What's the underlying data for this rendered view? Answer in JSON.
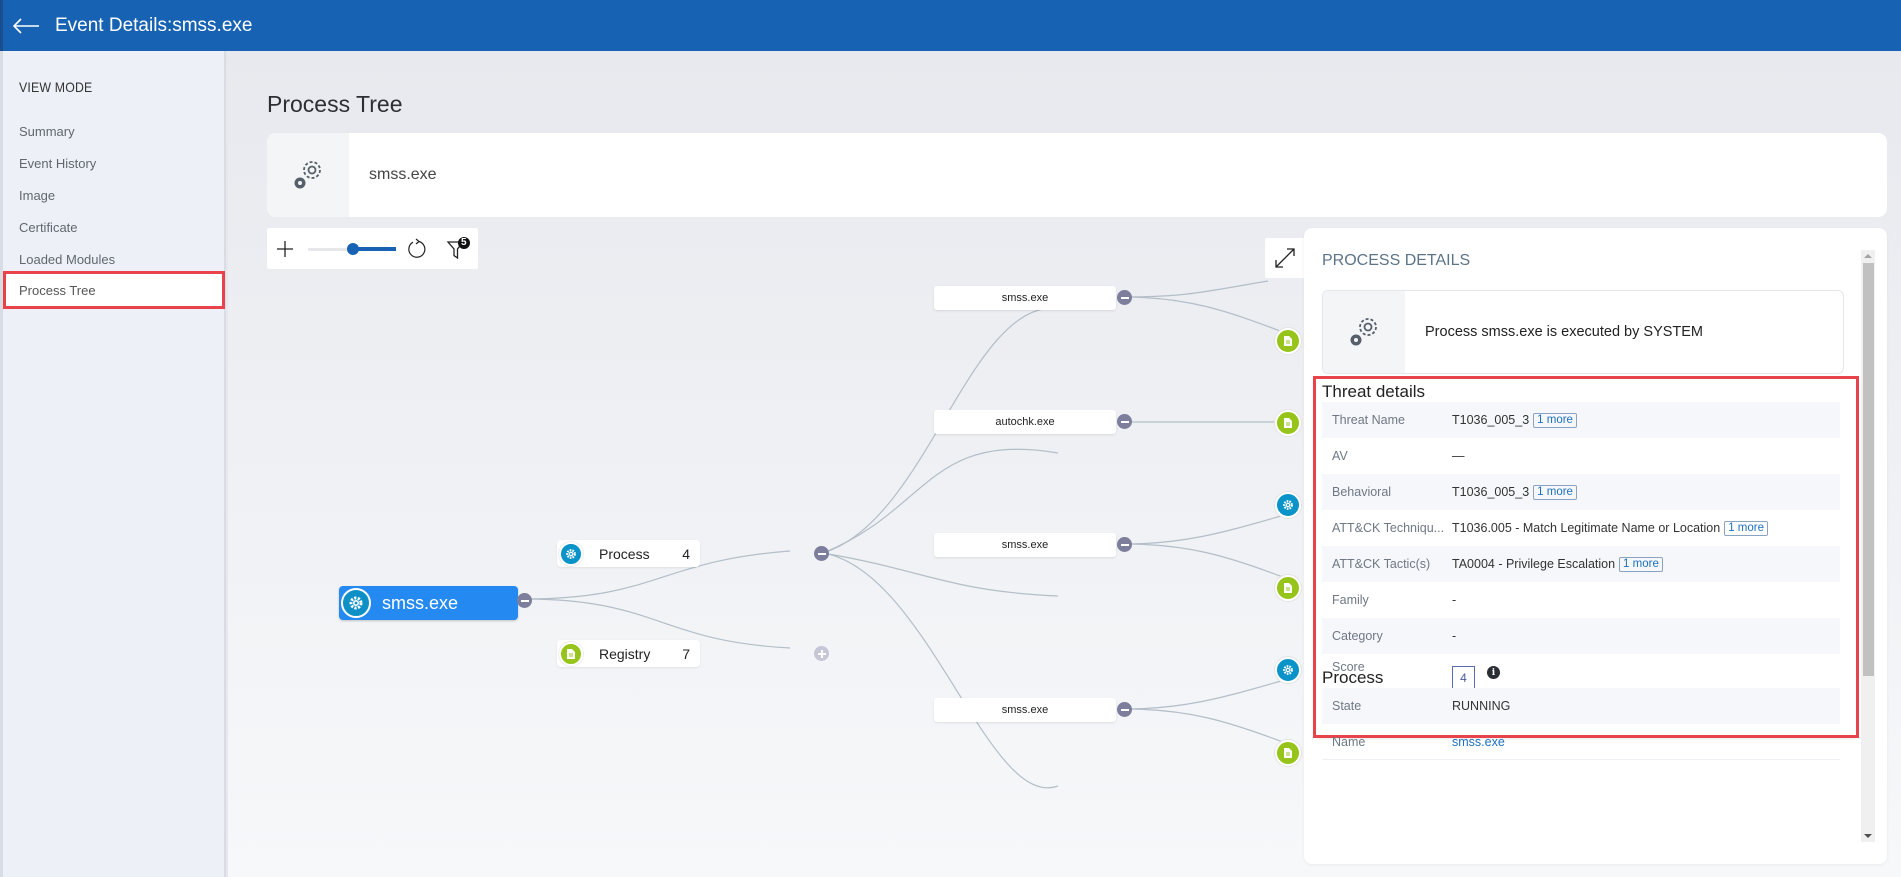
{
  "header": {
    "title": "Event Details:smss.exe",
    "back_icon": "arrow-left-icon"
  },
  "sidebar": {
    "heading": "VIEW MODE",
    "items": [
      {
        "label": "Summary",
        "active": false
      },
      {
        "label": "Event History",
        "active": false
      },
      {
        "label": "Image",
        "active": false
      },
      {
        "label": "Certificate",
        "active": false
      },
      {
        "label": "Loaded Modules",
        "active": false
      },
      {
        "label": "Process Tree",
        "active": true
      }
    ]
  },
  "main": {
    "title": "Process Tree",
    "process_card": {
      "name": "smss.exe",
      "icon": "gears-icon"
    },
    "toolbar": {
      "zoom_in_icon": "plus-icon",
      "zoom_out_icon": "minus-icon",
      "zoom_level": 0.3,
      "refresh_icon": "refresh-icon",
      "filter_icon": "filter-icon",
      "filter_badge": "5",
      "expand_icon": "expand-icon"
    },
    "tree": {
      "root": {
        "label": "smss.exe",
        "icon": "gear-icon"
      },
      "groups": [
        {
          "label": "Process",
          "count": "4",
          "icon": "gear-icon",
          "expanded": true
        },
        {
          "label": "Registry",
          "count": "7",
          "icon": "document-icon",
          "expanded": false
        }
      ],
      "children": [
        {
          "label": "smss.exe"
        },
        {
          "label": "autochk.exe"
        },
        {
          "label": "smss.exe"
        },
        {
          "label": "smss.exe"
        }
      ]
    }
  },
  "details": {
    "heading": "PROCESS DETAILS",
    "exec_summary": "Process smss.exe is executed by SYSTEM",
    "threat": {
      "title": "Threat details",
      "rows": [
        {
          "key": "Threat Name",
          "value": "T1036_005_3",
          "more": "1 more"
        },
        {
          "key": "AV",
          "value": "—",
          "more": null
        },
        {
          "key": "Behavioral",
          "value": "T1036_005_3",
          "more": "1 more"
        },
        {
          "key": "ATT&CK Techniqu...",
          "value": "T1036.005 - Match Legitimate Name or Location",
          "more": "1 more"
        },
        {
          "key": "ATT&CK Tactic(s)",
          "value": "TA0004 - Privilege Escalation",
          "more": "1 more"
        },
        {
          "key": "Family",
          "value": "-",
          "more": null
        },
        {
          "key": "Category",
          "value": "-",
          "more": null
        },
        {
          "key": "Score",
          "value": "4",
          "more": null
        }
      ]
    },
    "process": {
      "title": "Process",
      "rows": [
        {
          "key": "State",
          "value": "RUNNING"
        },
        {
          "key": "Name",
          "value": "smss.exe"
        }
      ]
    }
  },
  "colors": {
    "header_bg": "#1862b3",
    "root_node": "#2489f0",
    "process_icon": "#0a93c9",
    "registry_icon": "#97c41a",
    "highlight": "#e8434b"
  }
}
